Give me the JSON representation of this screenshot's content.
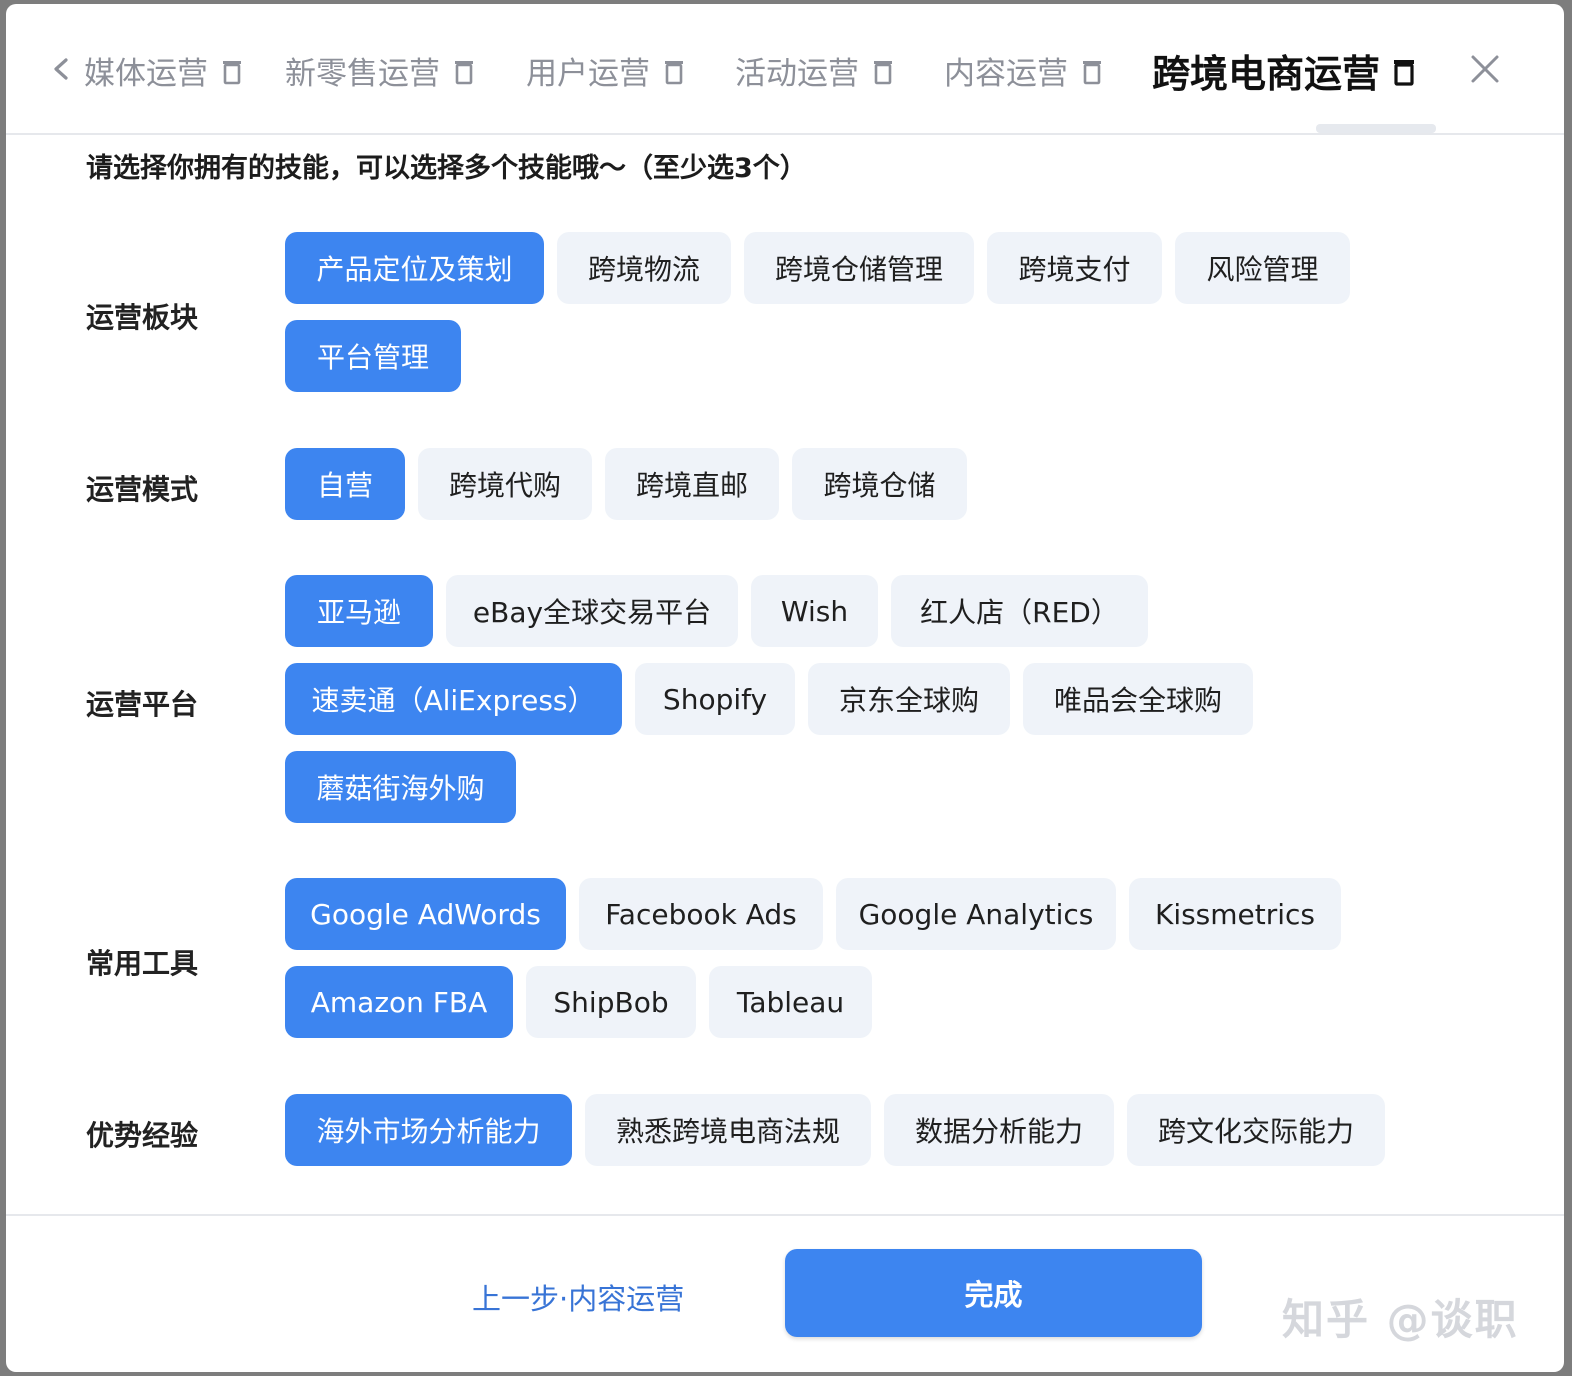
{
  "tabs": [
    {
      "label": "媒体运营",
      "active": false
    },
    {
      "label": "新零售运营",
      "active": false
    },
    {
      "label": "用户运营",
      "active": false
    },
    {
      "label": "活动运营",
      "active": false
    },
    {
      "label": "内容运营",
      "active": false
    },
    {
      "label": "跨境电商运营",
      "active": true
    }
  ],
  "instruction": "请选择你拥有的技能，可以选择多个技能哦～（至少选3个）",
  "sections": {
    "module": {
      "label": "运营板块",
      "chips": [
        {
          "text": "产品定位及策划",
          "selected": true
        },
        {
          "text": "跨境物流",
          "selected": false
        },
        {
          "text": "跨境仓储管理",
          "selected": false
        },
        {
          "text": "跨境支付",
          "selected": false
        },
        {
          "text": "风险管理",
          "selected": false
        },
        {
          "text": "平台管理",
          "selected": true
        }
      ]
    },
    "mode": {
      "label": "运营模式",
      "chips": [
        {
          "text": "自营",
          "selected": true
        },
        {
          "text": "跨境代购",
          "selected": false
        },
        {
          "text": "跨境直邮",
          "selected": false
        },
        {
          "text": "跨境仓储",
          "selected": false
        }
      ]
    },
    "platform": {
      "label": "运营平台",
      "chips": [
        {
          "text": "亚马逊",
          "selected": true
        },
        {
          "text": "eBay全球交易平台",
          "selected": false
        },
        {
          "text": "Wish",
          "selected": false
        },
        {
          "text": "红人店（RED）",
          "selected": false
        },
        {
          "text": "速卖通（AliExpress）",
          "selected": true
        },
        {
          "text": "Shopify",
          "selected": false
        },
        {
          "text": "京东全球购",
          "selected": false
        },
        {
          "text": "唯品会全球购",
          "selected": false
        },
        {
          "text": "蘑菇街海外购",
          "selected": true
        }
      ]
    },
    "tools": {
      "label": "常用工具",
      "chips": [
        {
          "text": "Google AdWords",
          "selected": true
        },
        {
          "text": "Facebook Ads",
          "selected": false
        },
        {
          "text": "Google Analytics",
          "selected": false
        },
        {
          "text": "Kissmetrics",
          "selected": false
        },
        {
          "text": "Amazon FBA",
          "selected": true
        },
        {
          "text": "ShipBob",
          "selected": false
        },
        {
          "text": "Tableau",
          "selected": false
        }
      ]
    },
    "experience": {
      "label": "优势经验",
      "chips": [
        {
          "text": "海外市场分析能力",
          "selected": true
        },
        {
          "text": "熟悉跨境电商法规",
          "selected": false
        },
        {
          "text": "数据分析能力",
          "selected": false
        },
        {
          "text": "跨文化交际能力",
          "selected": false
        }
      ]
    }
  },
  "footer": {
    "prev_label": "上一步·内容运营",
    "done_label": "完成",
    "watermark": "知乎 @谈职"
  },
  "colors": {
    "accent": "#3d85f0",
    "chip_bg": "#eff3f9",
    "link": "#3874d6"
  }
}
